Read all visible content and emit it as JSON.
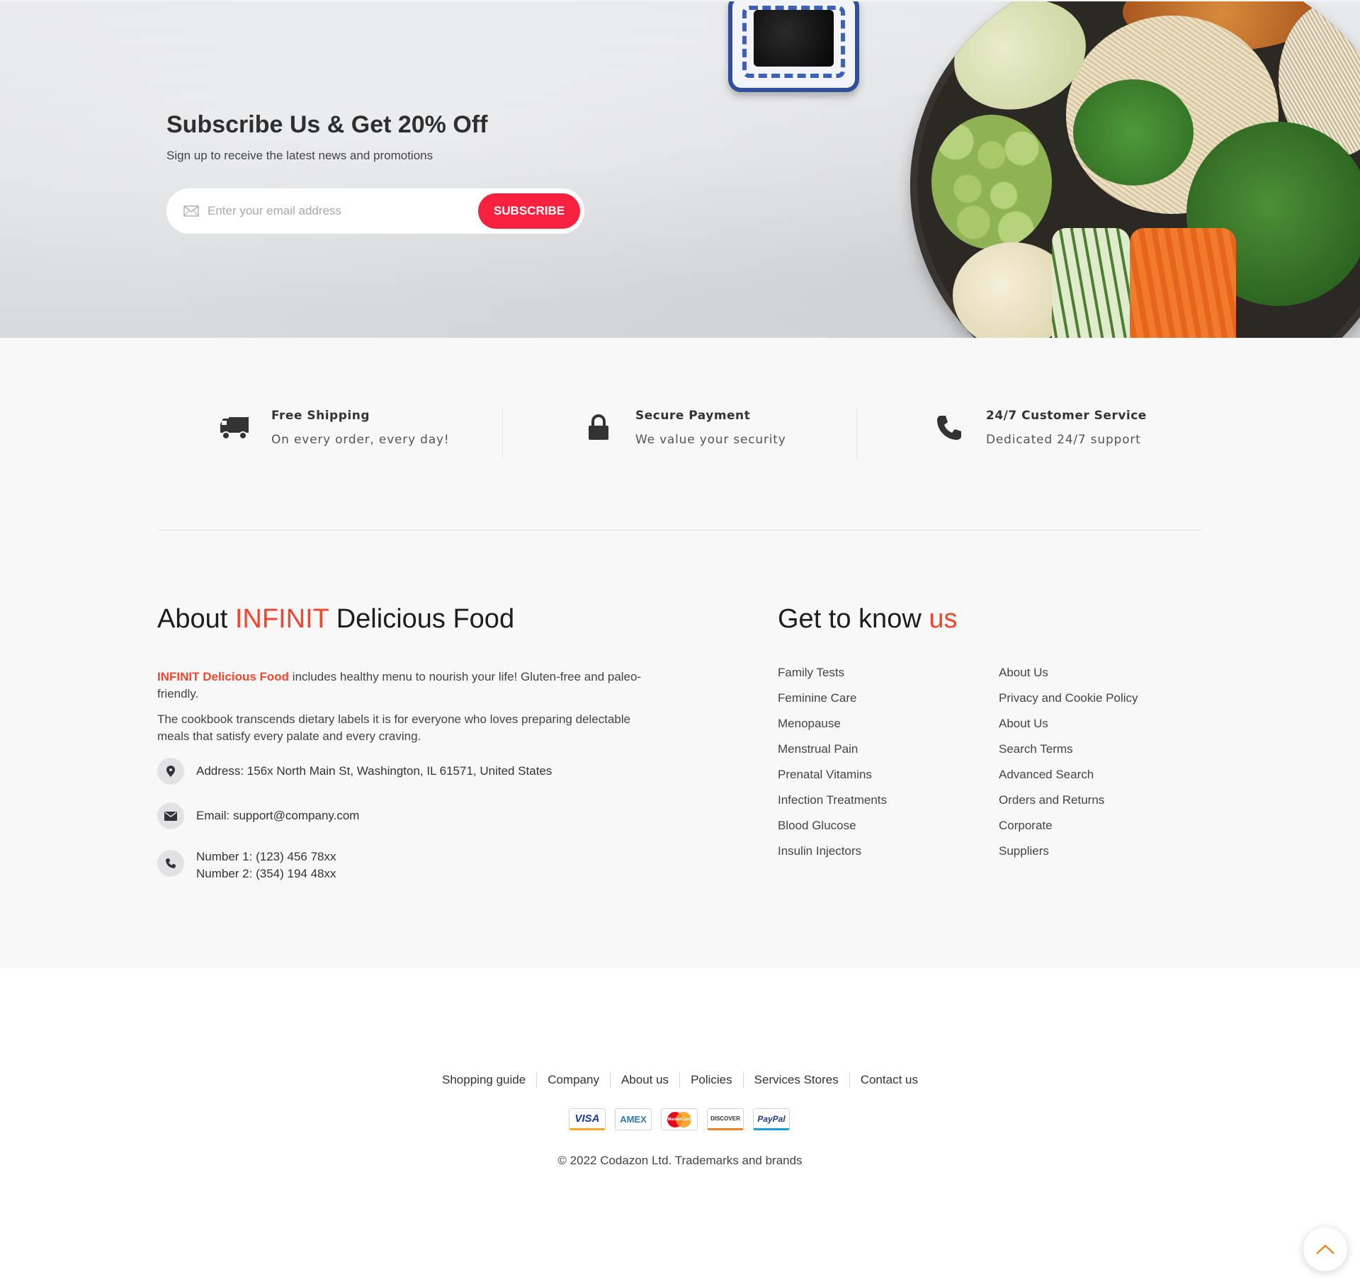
{
  "newsletter": {
    "title": "Subscribe Us & Get 20% Off",
    "subtitle": "Sign up to receive the latest news and promotions",
    "email_placeholder": "Enter your email address",
    "subscribe_label": "SUBSCRIBE"
  },
  "services": [
    {
      "icon": "truck-icon",
      "title": "Free Shipping",
      "desc": "On every order, every day!"
    },
    {
      "icon": "lock-icon",
      "title": "Secure Payment",
      "desc": "We value your security"
    },
    {
      "icon": "phone-icon",
      "title": "24/7 Customer Service",
      "desc": "Dedicated 24/7 support"
    }
  ],
  "about": {
    "title_pre": "About ",
    "title_accent": "INFINIT",
    "title_post": " Delicious Food",
    "p1_brand": "INFINIT Delicious Food",
    "p1_rest": " includes healthy menu to nourish your life! Gluten-free and paleo-friendly.",
    "p2": "The cookbook transcends dietary labels it is for everyone who loves preparing delectable meals that satisfy every palate and every craving.",
    "address": "Address: 156x North Main St, Washington, IL 61571, United States",
    "email": "Email: support@company.com",
    "phone1": "Number 1: (123) 456 78xx",
    "phone2": "Number 2: (354) 194 48xx"
  },
  "know": {
    "title_pre": "Get to know ",
    "title_accent": "us",
    "col1": [
      "Family Tests",
      "Feminine Care",
      "Menopause",
      "Menstrual Pain",
      "Prenatal Vitamins",
      "Infection Treatments",
      "Blood Glucose",
      "Insulin Injectors"
    ],
    "col2": [
      "About Us",
      "Privacy and Cookie Policy",
      "About Us",
      "Search Terms",
      "Advanced Search",
      "Orders and Returns",
      "Corporate",
      "Suppliers"
    ]
  },
  "bottom_nav": [
    "Shopping guide",
    "Company",
    "About us",
    "Policies",
    "Services Stores",
    "Contact us"
  ],
  "payments": [
    {
      "label": "VISA",
      "color": "#1a3d8f"
    },
    {
      "label": "AMEX",
      "color": "#2e77bb"
    },
    {
      "label": "MasterCard",
      "color": "#eb001b"
    },
    {
      "label": "DISCOVER",
      "color": "#333333"
    },
    {
      "label": "PayPal",
      "color": "#253b80"
    }
  ],
  "copyright": "© 2022 Codazon Ltd. Trademarks and brands",
  "colors": {
    "accent": "#f2452b",
    "subscribe": "#f5213f",
    "to_top_arrow": "#f2852b"
  }
}
